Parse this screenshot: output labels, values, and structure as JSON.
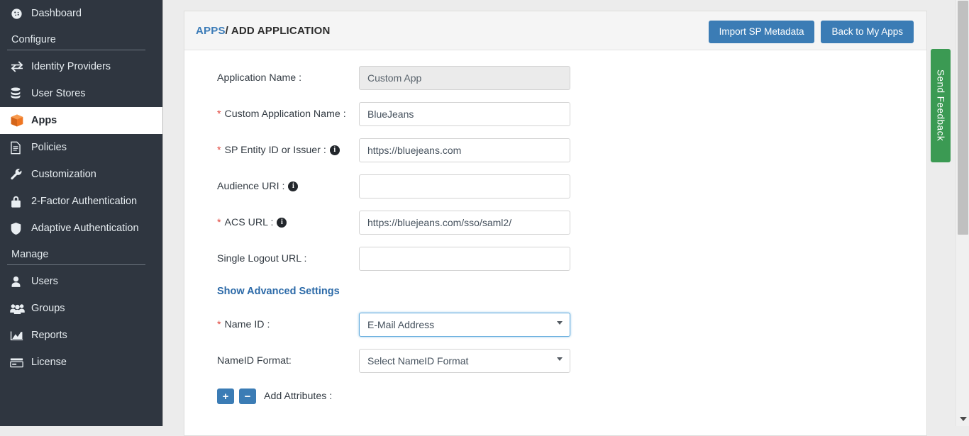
{
  "sidebar": {
    "top_items": [
      {
        "label": "Dashboard",
        "icon": "dashboard-icon",
        "active": false
      }
    ],
    "sections": [
      {
        "title": "Configure",
        "items": [
          {
            "label": "Identity Providers",
            "icon": "exchange-icon",
            "active": false
          },
          {
            "label": "User Stores",
            "icon": "database-icon",
            "active": false
          },
          {
            "label": "Apps",
            "icon": "box-icon",
            "active": true
          },
          {
            "label": "Policies",
            "icon": "document-icon",
            "active": false
          },
          {
            "label": "Customization",
            "icon": "wrench-icon",
            "active": false
          },
          {
            "label": "2-Factor Authentication",
            "icon": "lock-icon",
            "active": false
          },
          {
            "label": "Adaptive Authentication",
            "icon": "shield-icon",
            "active": false
          }
        ]
      },
      {
        "title": "Manage",
        "items": [
          {
            "label": "Users",
            "icon": "user-icon",
            "active": false
          },
          {
            "label": "Groups",
            "icon": "users-group-icon",
            "active": false
          },
          {
            "label": "Reports",
            "icon": "chart-icon",
            "active": false
          },
          {
            "label": "License",
            "icon": "card-icon",
            "active": false
          }
        ]
      }
    ]
  },
  "header": {
    "breadcrumb_root": "APPS",
    "breadcrumb_sep": "/",
    "breadcrumb_current": "ADD APPLICATION",
    "import_button": "Import SP Metadata",
    "back_button": "Back to My Apps"
  },
  "form": {
    "fields": [
      {
        "label": "Application Name :",
        "required": false,
        "has_info": false,
        "type": "text",
        "value": "Custom App",
        "placeholder": "",
        "disabled": true
      },
      {
        "label": "Custom Application Name :",
        "required": true,
        "has_info": false,
        "type": "text",
        "value": "BlueJeans",
        "placeholder": "",
        "disabled": false
      },
      {
        "label": "SP Entity ID or Issuer :",
        "required": true,
        "has_info": true,
        "type": "text",
        "value": "https://bluejeans.com",
        "placeholder": "",
        "disabled": false
      },
      {
        "label": "Audience URI :",
        "required": false,
        "has_info": true,
        "type": "text",
        "value": "",
        "placeholder": "",
        "disabled": false
      },
      {
        "label": "ACS URL :",
        "required": true,
        "has_info": true,
        "type": "text",
        "value": "https://bluejeans.com/sso/saml2/",
        "placeholder": "",
        "disabled": false
      },
      {
        "label": "Single Logout URL :",
        "required": false,
        "has_info": false,
        "type": "text",
        "value": "",
        "placeholder": "",
        "disabled": false
      }
    ],
    "advanced_link": "Show Advanced Settings",
    "selects": [
      {
        "label": "Name ID :",
        "required": true,
        "value": "E-Mail Address",
        "focused": true
      },
      {
        "label": "NameID Format:",
        "required": false,
        "value": "Select NameID Format",
        "focused": false
      }
    ],
    "attributes": {
      "add_label": "+",
      "remove_label": "−",
      "label": "Add Attributes :"
    }
  },
  "feedback": {
    "label": "Send Feedback"
  },
  "colors": {
    "sidebar_bg": "#2f3640",
    "accent_blue": "#3b7cb5",
    "link_blue": "#2c6aa8",
    "feedback_green": "#3b9a53",
    "required_red": "#e0443b",
    "apps_icon_orange": "#ef7622"
  }
}
